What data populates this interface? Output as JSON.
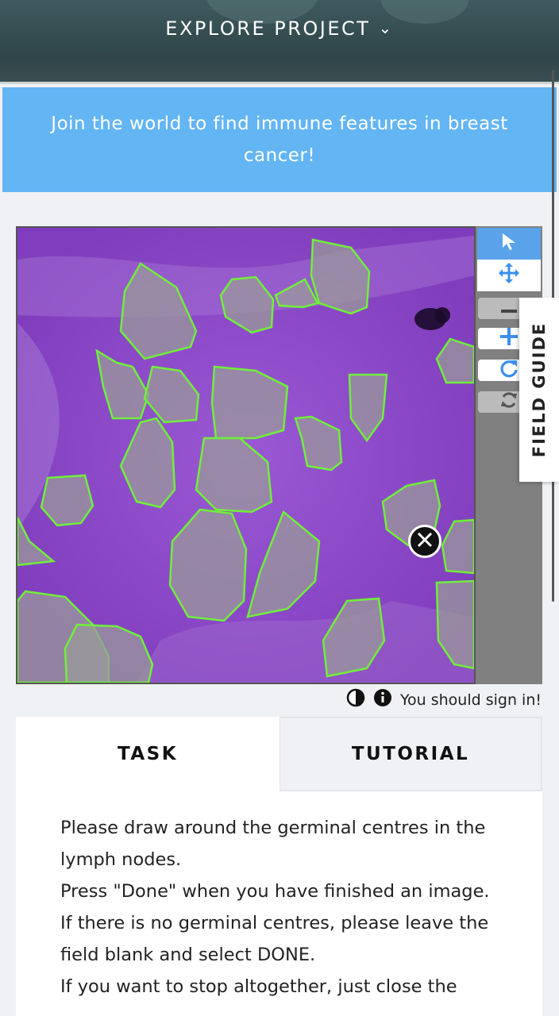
{
  "header": {
    "explore_label": "EXPLORE PROJECT",
    "chevron_icon": "chevron-down-icon"
  },
  "banner": {
    "text": "Join the world to find immune features in breast cancer!"
  },
  "viewer": {
    "image_description": "lymph-node-tissue-image",
    "outline_color": "#6ff03a",
    "tools": [
      {
        "icon": "pointer-icon"
      },
      {
        "icon": "move-icon"
      },
      {
        "icon": "zoom-out-icon"
      },
      {
        "icon": "zoom-in-icon"
      },
      {
        "icon": "rotate-icon"
      },
      {
        "icon": "reset-icon"
      }
    ]
  },
  "field_guide": {
    "label": "FIELD GUIDE"
  },
  "meta": {
    "sign_in_text": "You should sign in!"
  },
  "tabs": {
    "task_label": "TASK",
    "tutorial_label": "TUTORIAL"
  },
  "task": {
    "lines": [
      "Please draw around the germinal centres in the lymph nodes.",
      "Press \"Done\" when you have finished an image.",
      "If there is no germinal centres, please leave the field blank and select DONE.",
      "If you want to stop altogether, just close the"
    ]
  },
  "colors": {
    "banner_bg": "#63b5f4",
    "accent_blue": "#3a8ff0",
    "tissue_purple": "#8a45c7",
    "outline_green": "#6ff03a"
  }
}
